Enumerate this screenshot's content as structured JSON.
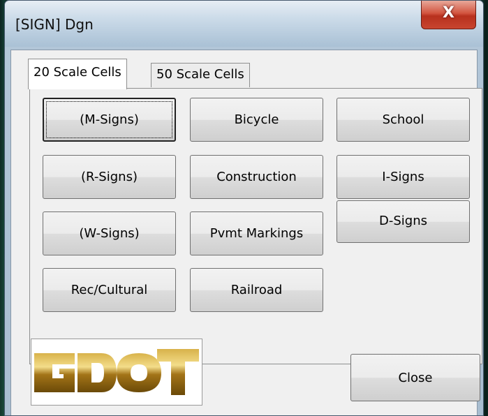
{
  "window": {
    "title": "[SIGN] Dgn",
    "close_glyph": "X"
  },
  "tabs": [
    {
      "label": "20 Scale Cells",
      "selected": true
    },
    {
      "label": "50 Scale Cells",
      "selected": false
    }
  ],
  "buttons": {
    "m_signs": "(M-Signs)",
    "r_signs": "(R-Signs)",
    "w_signs": "(W-Signs)",
    "rec_cultural": "Rec/Cultural",
    "bicycle": "Bicycle",
    "construction": "Construction",
    "pvmt_markings": "Pvmt Markings",
    "railroad": "Railroad",
    "school": "School",
    "i_signs": "I-Signs",
    "d_signs": "D-Signs",
    "close": "Close"
  },
  "logo": {
    "text": "GDOT",
    "color": "#a07a1a"
  },
  "colors": {
    "close_accent": "#c8452f"
  }
}
